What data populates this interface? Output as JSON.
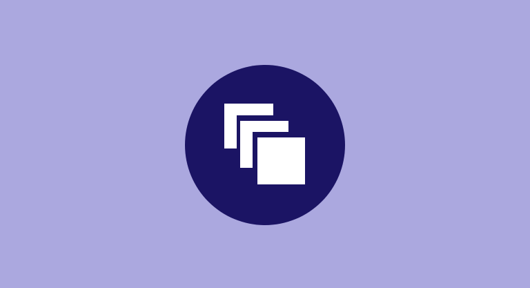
{
  "colors": {
    "background": "#aba8df",
    "badge": "#1b1464",
    "icon": "#ffffff"
  },
  "icon": {
    "name": "stacked-pages-icon"
  }
}
